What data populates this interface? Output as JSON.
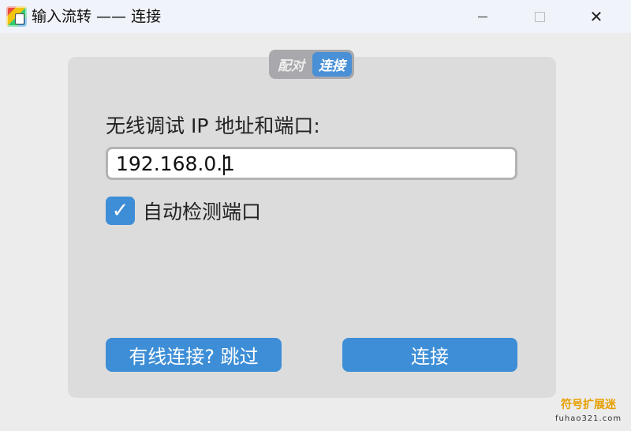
{
  "window": {
    "title": "输入流转 —— 连接",
    "minimize": "",
    "maximize": "",
    "close": "✕"
  },
  "tabs": {
    "pair": "配对",
    "connect": "连接",
    "active": "连接"
  },
  "form": {
    "ip_label": "无线调试 IP 地址和端口:",
    "ip_value": "192.168.0.1",
    "auto_detect_label": "自动检测端口",
    "auto_detect_checked": true,
    "check_glyph": "✓"
  },
  "buttons": {
    "skip": "有线连接? 跳过",
    "connect": "连接"
  },
  "watermark": {
    "title": "符号扩展迷",
    "subtitle": "fuhao321.com"
  },
  "colors": {
    "accent": "#3d8ed6",
    "card": "#dcdcdc",
    "background": "#ececec"
  }
}
